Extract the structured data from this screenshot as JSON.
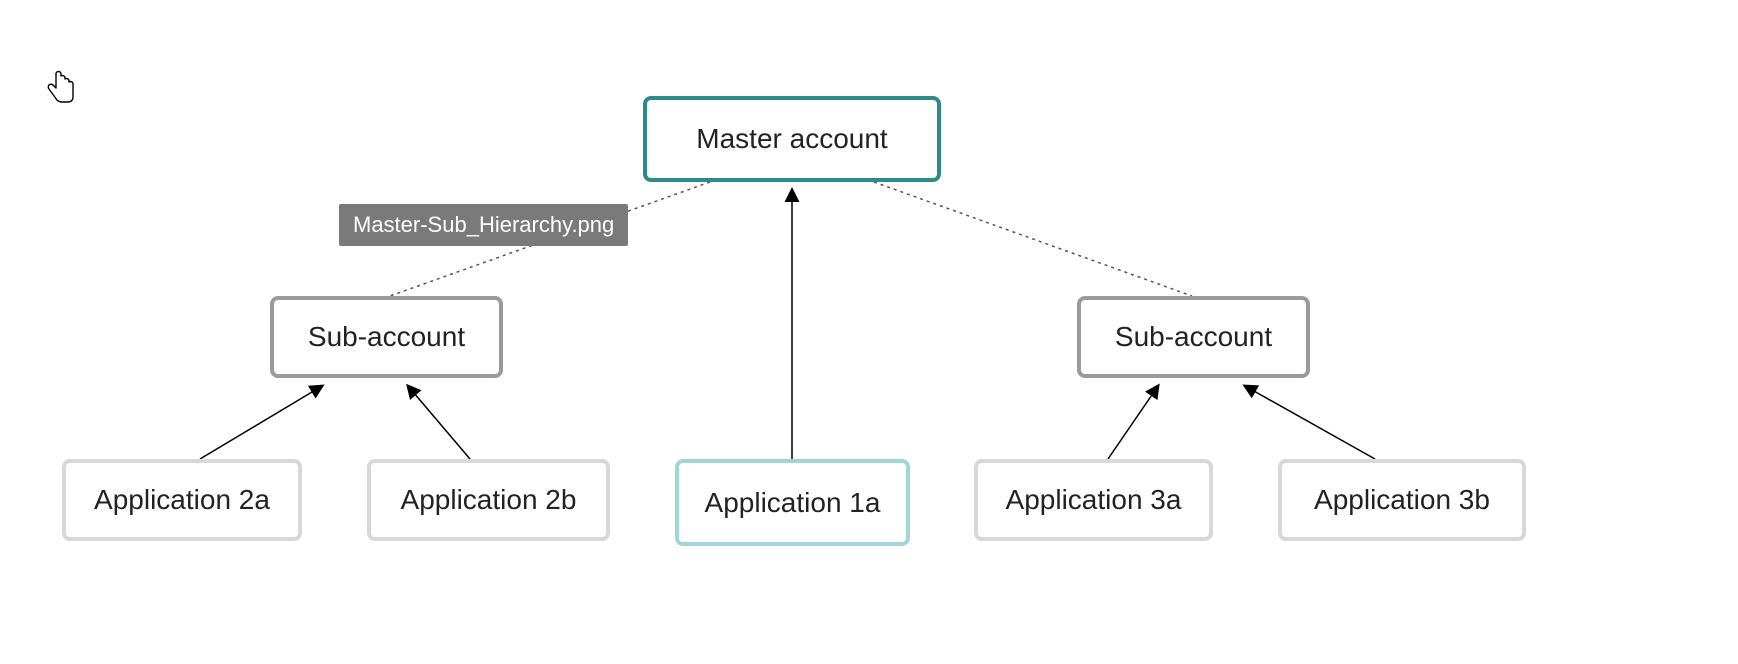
{
  "tooltip": "Master-Sub_Hierarchy.png",
  "nodes": {
    "master": "Master account",
    "sub_left": "Sub-account",
    "sub_right": "Sub-account",
    "app_2a": "Application 2a",
    "app_2b": "Application 2b",
    "app_1a": "Application 1a",
    "app_3a": "Application 3a",
    "app_3b": "Application 3b"
  },
  "colors": {
    "master_border": "#2e8a8a",
    "sub_border": "#9a9a9a",
    "app_border": "#d8d8d8",
    "app_1a_border": "#a1d6d9",
    "tooltip_bg": "#7a7a7a"
  },
  "hierarchy": {
    "master": {
      "children_dotted": [
        "sub_left",
        "sub_right"
      ],
      "children_solid_arrow_up": [
        "app_1a"
      ]
    },
    "sub_left": {
      "children_solid_arrow_up": [
        "app_2a",
        "app_2b"
      ]
    },
    "sub_right": {
      "children_solid_arrow_up": [
        "app_3a",
        "app_3b"
      ]
    }
  }
}
